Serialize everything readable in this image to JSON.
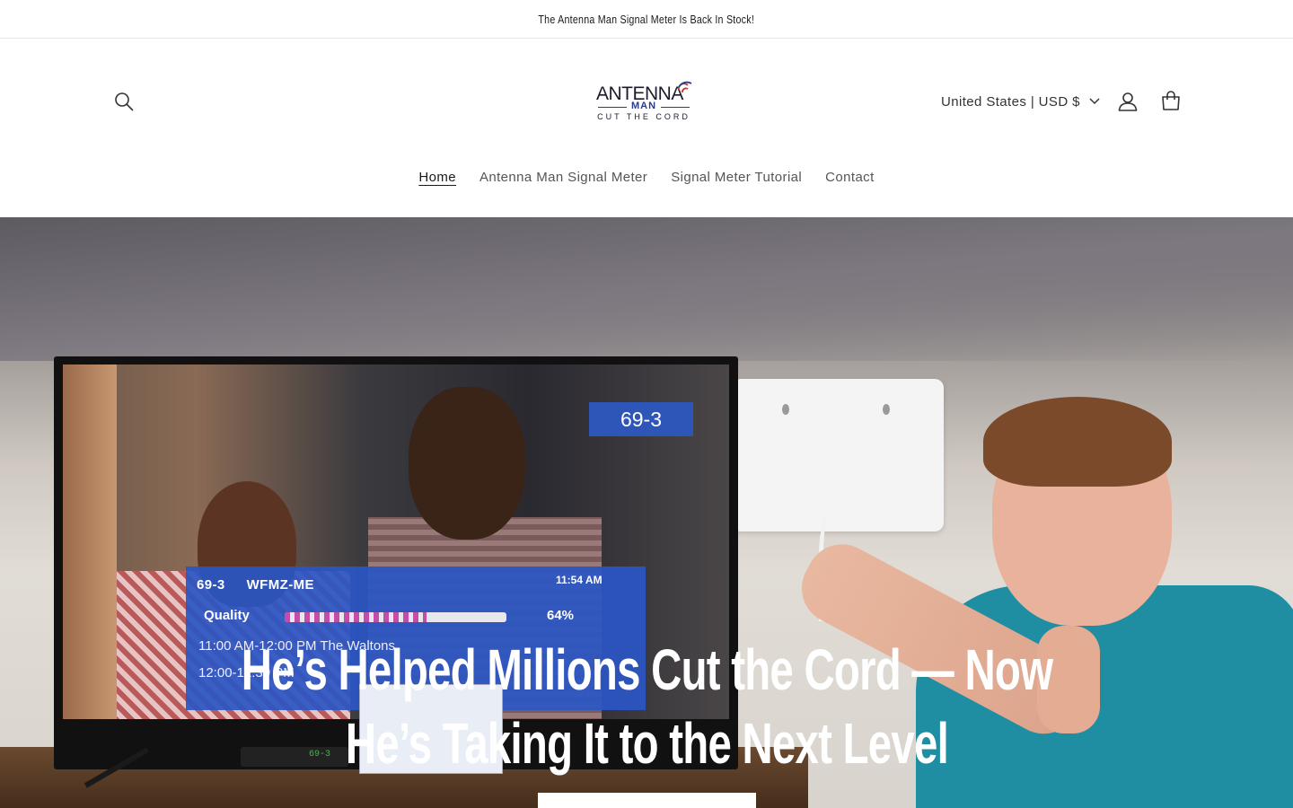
{
  "announcement": {
    "text": "The Antenna Man Signal Meter Is Back In Stock!"
  },
  "header": {
    "logo": {
      "line1": "ANTENNA",
      "line2": "MAN",
      "line3": "CUT THE CORD"
    },
    "currency_selector": "United States | USD $",
    "icons": {
      "search": "search-icon",
      "account": "account-icon",
      "cart": "cart-icon",
      "chevron": "chevron-down-icon"
    }
  },
  "nav": {
    "items": [
      {
        "label": "Home",
        "active": true
      },
      {
        "label": "Antenna Man Signal Meter",
        "active": false
      },
      {
        "label": "Signal Meter Tutorial",
        "active": false
      },
      {
        "label": "Contact",
        "active": false
      }
    ]
  },
  "hero": {
    "headline_line1": "He’s Helped Millions Cut the Cord — Now",
    "headline_line2": "He’s Taking It to the Next Level",
    "tv_overlay": {
      "channel_badge": "69-3",
      "channel": "69-3",
      "station": "WFMZ-ME",
      "time": "11:54 AM",
      "quality_label": "Quality",
      "quality_value": "64%",
      "quality_fraction": 0.64,
      "program_line1": "11:00 AM-12:00 PM The Waltons",
      "program_line2": "12:00-12:30 PM",
      "receiver_display": "69-3"
    }
  },
  "colors": {
    "accent": "#2b3a8a",
    "osd_blue": "#2a56c4",
    "text": "#1a1a1a"
  }
}
